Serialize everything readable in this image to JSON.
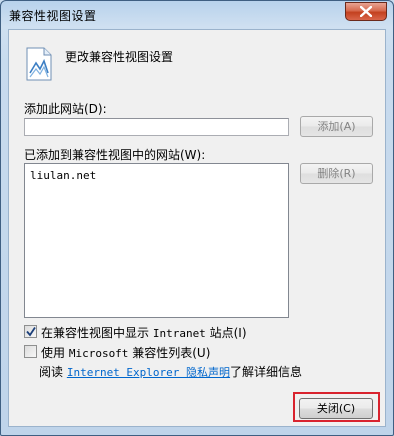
{
  "window": {
    "title": "兼容性视图设置"
  },
  "header": {
    "text": "更改兼容性视图设置"
  },
  "add_site": {
    "label": "添加此网站(D):",
    "input_value": "",
    "add_button": "添加(A)"
  },
  "site_list": {
    "label": "已添加到兼容性视图中的网站(W):",
    "items": [
      "liulan.net"
    ],
    "remove_button": "删除(R)"
  },
  "options": {
    "intranet_prefix": "在兼容性视图中显示 ",
    "intranet_mono": "Intranet",
    "intranet_suffix": " 站点(I)",
    "intranet_checked": true,
    "mslist_prefix": "使用 ",
    "mslist_mono": "Microsoft",
    "mslist_suffix": " 兼容性列表(U)",
    "mslist_checked": false
  },
  "privacy": {
    "prefix": "阅读 ",
    "link_text": "Internet Explorer 隐私声明",
    "suffix": "了解详细信息"
  },
  "footer": {
    "close_button": "关闭(C)"
  },
  "colors": {
    "link": "#0066cc",
    "highlight": "#d9232e"
  }
}
